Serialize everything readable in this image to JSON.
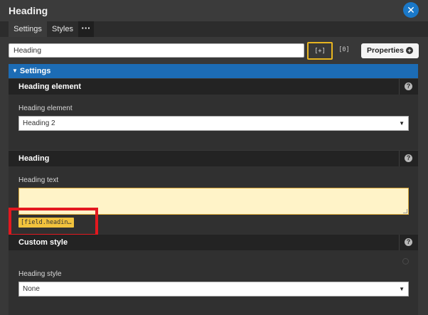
{
  "dialog": {
    "title": "Heading",
    "close_label": "✕"
  },
  "tabs": [
    {
      "label": "Settings",
      "active": true
    },
    {
      "label": "Styles",
      "active": false
    },
    {
      "label": "···",
      "active": false
    }
  ],
  "toolbar": {
    "name_value": "Heading",
    "bracket_btn_1": "[+]",
    "bracket_btn_2": "[0]",
    "properties_label": "Properties",
    "properties_icon": "+"
  },
  "settings_bar": {
    "label": "Settings",
    "caret": "▼"
  },
  "sections": {
    "heading_element": {
      "title": "Heading element",
      "help": "?",
      "field_label": "Heading element",
      "selected": "Heading 2"
    },
    "heading": {
      "title": "Heading",
      "help": "?",
      "field_label": "Heading text",
      "textarea_value": "",
      "field_chip": "[field.headin…"
    },
    "custom_style": {
      "title": "Custom style",
      "help": "?",
      "field_label": "Heading style",
      "selected": "None"
    }
  },
  "select_arrow": "▼",
  "colors": {
    "accent_blue": "#1c6cb5",
    "highlight_yellow": "#f2c33d",
    "annotation_red": "#e3181f"
  }
}
